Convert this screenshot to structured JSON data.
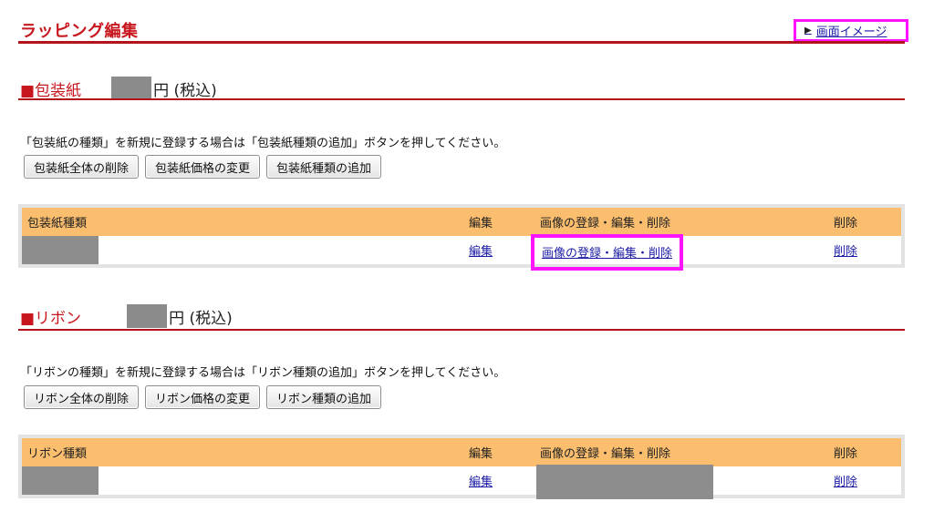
{
  "header": {
    "title": "ラッピング編集",
    "screen_image_link": "画面イメージ"
  },
  "wrapping": {
    "heading": "■包装紙",
    "price_suffix": "円 (税込)",
    "note": "「包装紙の種類」を新規に登録する場合は「包装紙種類の追加」ボタンを押してください。",
    "buttons": [
      "包装紙全体の削除",
      "包装紙価格の変更",
      "包装紙種類の追加"
    ],
    "columns": [
      "包装紙種類",
      "編集",
      "画像の登録・編集・削除",
      "削除"
    ],
    "row": {
      "edit": "編集",
      "image": "画像の登録・編集・削除",
      "delete": "削除"
    }
  },
  "ribbon": {
    "heading": "■リボン",
    "price_suffix": "円 (税込)",
    "note": "「リボンの種類」を新規に登録する場合は「リボン種類の追加」ボタンを押してください。",
    "buttons": [
      "リボン全体の削除",
      "リボン価格の変更",
      "リボン種類の追加"
    ],
    "columns": [
      "リボン種類",
      "編集",
      "画像の登録・編集・削除",
      "削除"
    ],
    "row": {
      "edit": "編集",
      "delete": "削除"
    }
  },
  "colors": {
    "accent": "#c8161e",
    "header_fill": "#fbbd6e",
    "highlight": "#ff14ff",
    "link": "#1a1aa6"
  }
}
